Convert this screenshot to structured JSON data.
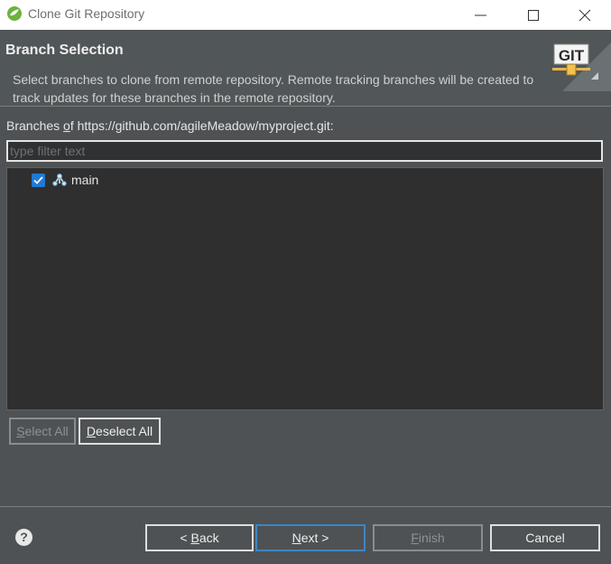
{
  "window": {
    "title": "Clone Git Repository"
  },
  "header": {
    "title": "Branch Selection",
    "description": "Select branches to clone from remote repository. Remote tracking branches will be created to track updates for these branches in the remote repository.",
    "logo_text": "GIT"
  },
  "branches": {
    "label_prefix": "Branches ",
    "label_mnemonic": "o",
    "label_mid": "f ",
    "label_url": "https://github.com/agileMeadow/myproject.git:",
    "filter_placeholder": "type filter text",
    "filter_value": "",
    "items": [
      {
        "name": "main",
        "checked": true
      }
    ]
  },
  "selection_buttons": {
    "select_all": {
      "mnemonic": "S",
      "rest": "elect All",
      "enabled": false
    },
    "deselect_all": {
      "mnemonic": "D",
      "rest": "eselect All",
      "enabled": true
    }
  },
  "footer": {
    "back": {
      "prefix": "< ",
      "mnemonic": "B",
      "rest": "ack"
    },
    "next": {
      "mnemonic": "N",
      "rest": "ext >"
    },
    "finish": {
      "mnemonic": "F",
      "rest": "inish",
      "enabled": false
    },
    "cancel": {
      "label": "Cancel"
    },
    "help_glyph": "?"
  },
  "colors": {
    "background": "#4e5254",
    "accent": "#1f7ad6",
    "tree_bg": "#2f2f2f"
  }
}
